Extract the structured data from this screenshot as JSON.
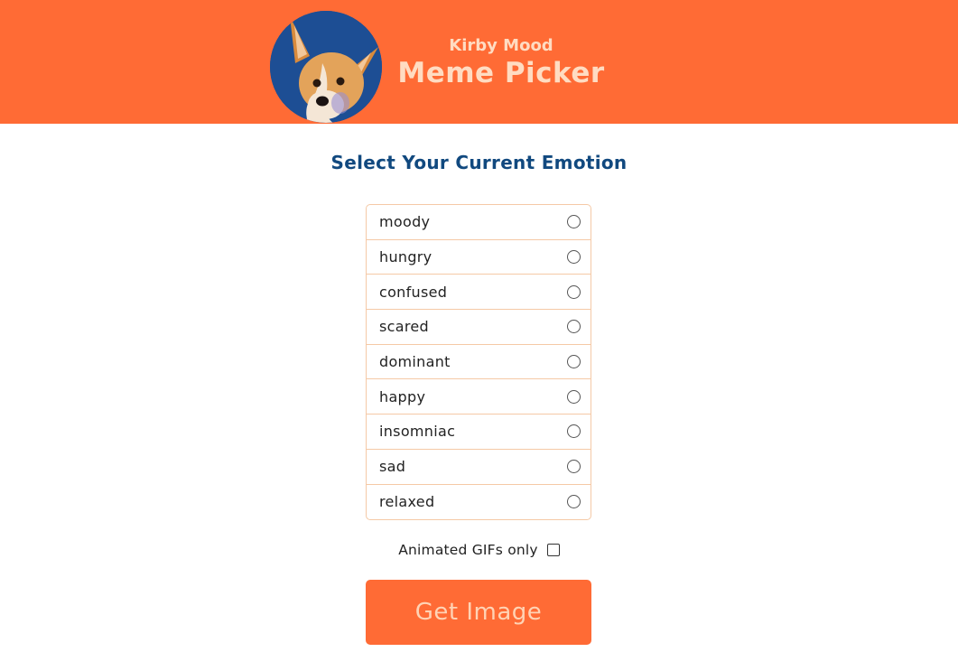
{
  "header": {
    "subtitle": "Kirby Mood",
    "title": "Meme Picker",
    "avatar_icon": "corgi-dog-photo",
    "background_color": "#ff6b35"
  },
  "main": {
    "heading": "Select Your Current Emotion",
    "emotions": [
      {
        "label": "moody",
        "selected": false
      },
      {
        "label": "hungry",
        "selected": false
      },
      {
        "label": "confused",
        "selected": false
      },
      {
        "label": "scared",
        "selected": false
      },
      {
        "label": "dominant",
        "selected": false
      },
      {
        "label": "happy",
        "selected": false
      },
      {
        "label": "insomniac",
        "selected": false
      },
      {
        "label": "sad",
        "selected": false
      },
      {
        "label": "relaxed",
        "selected": false
      }
    ],
    "gif_option": {
      "label": "Animated GIFs only",
      "checked": false
    },
    "submit_label": "Get Image",
    "accent_color": "#ff6b35",
    "heading_color": "#11497f"
  }
}
